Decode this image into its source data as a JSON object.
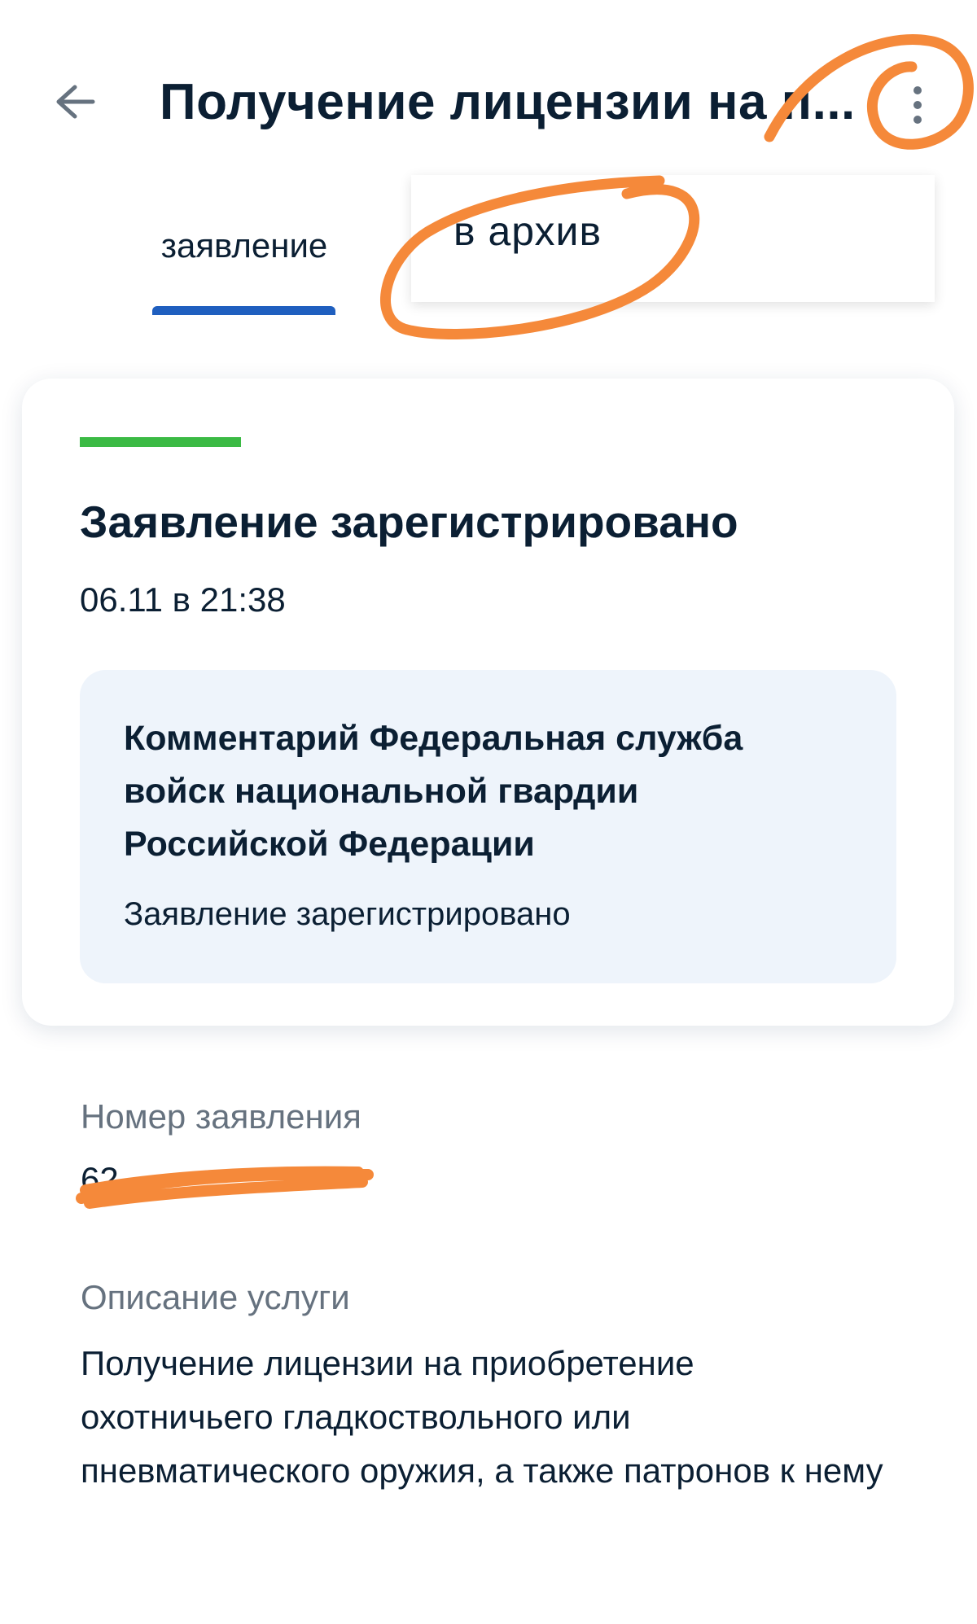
{
  "header": {
    "title": "Получение лицензии на п...",
    "back_icon": "arrow-left-icon",
    "more_icon": "more-vertical-icon"
  },
  "tabs": [
    {
      "label": "заявление",
      "active": true
    }
  ],
  "menu": {
    "items": [
      {
        "label": "в архив"
      }
    ]
  },
  "status_card": {
    "status_color": "#3bba44",
    "title": "Заявление зарегистрировано",
    "date": "06.11 в 21:38",
    "comment": {
      "title": "Комментарий Федеральная служба войск национальной гвардии Российской Федерации",
      "text": "Заявление зарегистрировано"
    }
  },
  "details": {
    "number_label": "Номер заявления",
    "number_value": "62",
    "description_label": "Описание услуги",
    "description_value": "Получение лицензии на приобретение охотничьего гладкоствольного или пневматического оружия, а также патронов к нему"
  },
  "colors": {
    "accent": "#1f5fbf",
    "annotation": "#f5893a",
    "status_ok": "#3bba44"
  }
}
